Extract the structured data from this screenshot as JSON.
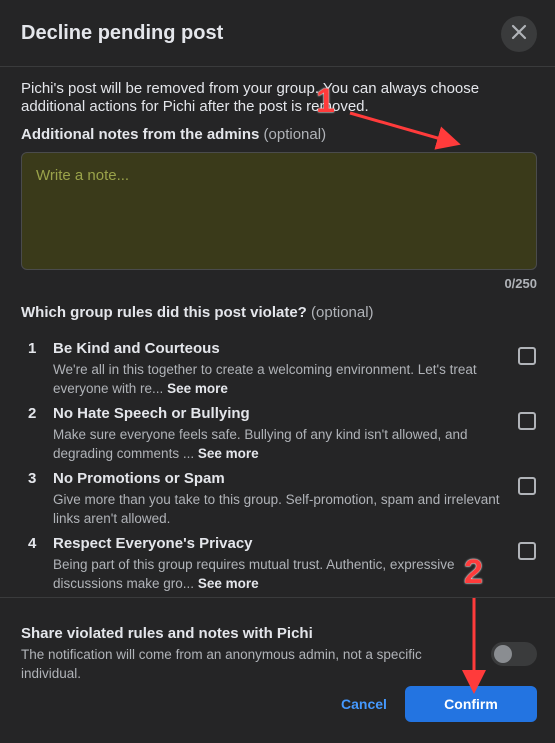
{
  "dialog": {
    "title": "Decline pending post",
    "description": "Pichi's post will be removed from your group. You can always choose additional actions for Pichi after the post is removed.",
    "notes_label": "Additional notes from the admins",
    "notes_optional": "(optional)",
    "notes_placeholder": "Write a note...",
    "notes_value": "",
    "notes_counter": "0/250",
    "rules_label": "Which group rules did this post violate?",
    "rules_optional": "(optional)",
    "see_more": "See more",
    "rules": [
      {
        "num": "1",
        "title": "Be Kind and Courteous",
        "desc": "We're all in this together to create a welcoming environment. Let's treat everyone with re...",
        "checked": false
      },
      {
        "num": "2",
        "title": "No Hate Speech or Bullying",
        "desc": "Make sure everyone feels safe. Bullying of any kind isn't allowed, and degrading comments ...",
        "checked": false
      },
      {
        "num": "3",
        "title": "No Promotions or Spam",
        "desc": "Give more than you take to this group. Self-promotion, spam and irrelevant links aren't allowed.",
        "checked": false
      },
      {
        "num": "4",
        "title": "Respect Everyone's Privacy",
        "desc": "Being part of this group requires mutual trust. Authentic, expressive discussions make gro...",
        "checked": false
      }
    ],
    "share_title": "Share violated rules and notes with Pichi",
    "share_desc": "The notification will come from an anonymous admin, not a specific individual.",
    "share_toggle_on": false,
    "cancel_label": "Cancel",
    "confirm_label": "Confirm"
  },
  "annotations": {
    "marker_1": "1",
    "marker_2": "2"
  },
  "icons": {
    "close": "close-icon"
  },
  "colors": {
    "accent": "#2374e1",
    "link": "#4599ff",
    "annotation": "#ff3b3b",
    "note_bg": "#3a3a1a"
  }
}
